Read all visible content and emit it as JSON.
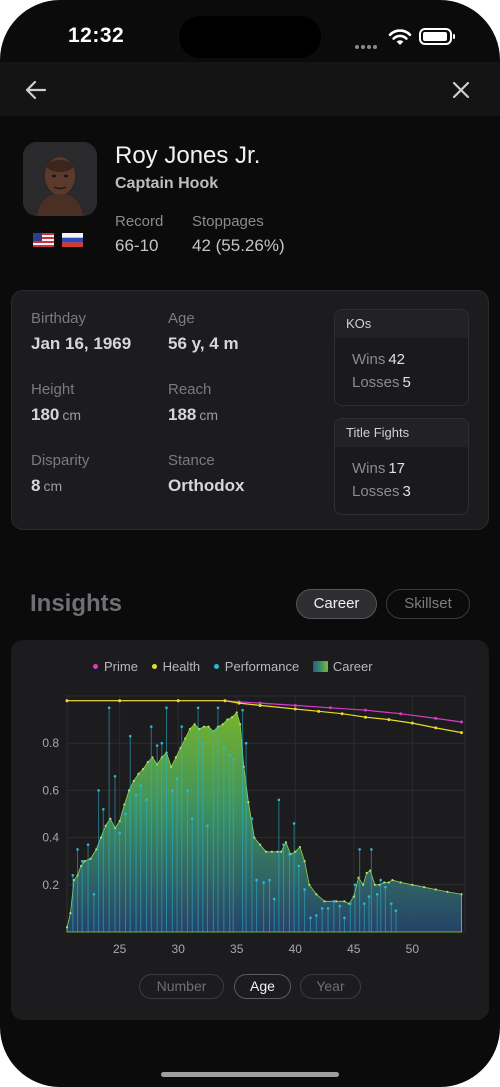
{
  "status_bar": {
    "time": "12:32"
  },
  "navbar": {
    "back_icon": "arrow-left-icon",
    "close_icon": "close-icon"
  },
  "fighter": {
    "name": "Roy Jones Jr.",
    "nickname": "Captain Hook",
    "flags": [
      "us-flag-icon",
      "ru-flag-icon"
    ],
    "record_label": "Record",
    "record_value": "66-10",
    "stoppages_label": "Stoppages",
    "stoppages_value": "42 (55.26%)"
  },
  "details": {
    "birthday_label": "Birthday",
    "birthday_value": "Jan 16, 1969",
    "age_label": "Age",
    "age_value": "56 y, 4 m",
    "height_label": "Height",
    "height_value": "180",
    "height_unit": "cm",
    "reach_label": "Reach",
    "reach_value": "188",
    "reach_unit": "cm",
    "disparity_label": "Disparity",
    "disparity_value": "8",
    "disparity_unit": "cm",
    "stance_label": "Stance",
    "stance_value": "Orthodox"
  },
  "kos": {
    "title": "KOs",
    "wins_label": "Wins",
    "wins_value": "42",
    "losses_label": "Losses",
    "losses_value": "5"
  },
  "title_fights": {
    "title": "Title Fights",
    "wins_label": "Wins",
    "wins_value": "17",
    "losses_label": "Losses",
    "losses_value": "3"
  },
  "insights": {
    "title": "Insights",
    "tabs": [
      {
        "label": "Career",
        "active": true
      },
      {
        "label": "Skillset",
        "active": false
      }
    ],
    "x_modes": [
      {
        "label": "Number",
        "active": false
      },
      {
        "label": "Age",
        "active": true
      },
      {
        "label": "Year",
        "active": false
      }
    ]
  },
  "chart_data": {
    "type": "area",
    "legend": [
      "Prime",
      "Health",
      "Performance",
      "Career"
    ],
    "colors": {
      "Prime": "#d63bc8",
      "Health": "#e8dc2a",
      "Performance": "#2ab8d8",
      "Career": "#7db836"
    },
    "xlim": [
      20.5,
      54.5
    ],
    "ylim": [
      0,
      1
    ],
    "x_ticks": [
      "25",
      "30",
      "35",
      "40",
      "45",
      "50"
    ],
    "y_ticks": [
      "0.2",
      "0.4",
      "0.6",
      "0.8"
    ],
    "grid": true,
    "series": [
      {
        "name": "Career",
        "points": [
          [
            20.5,
            0.02
          ],
          [
            20.8,
            0.08
          ],
          [
            21.1,
            0.22
          ],
          [
            21.4,
            0.24
          ],
          [
            21.7,
            0.28
          ],
          [
            22.0,
            0.3
          ],
          [
            22.5,
            0.31
          ],
          [
            23.0,
            0.35
          ],
          [
            23.4,
            0.4
          ],
          [
            23.8,
            0.45
          ],
          [
            24.2,
            0.48
          ],
          [
            24.6,
            0.44
          ],
          [
            25.0,
            0.47
          ],
          [
            25.4,
            0.54
          ],
          [
            25.8,
            0.6
          ],
          [
            26.2,
            0.64
          ],
          [
            26.6,
            0.67
          ],
          [
            27.0,
            0.69
          ],
          [
            27.4,
            0.72
          ],
          [
            27.8,
            0.74
          ],
          [
            28.2,
            0.71
          ],
          [
            28.6,
            0.74
          ],
          [
            29.0,
            0.76
          ],
          [
            29.4,
            0.7
          ],
          [
            29.8,
            0.74
          ],
          [
            30.2,
            0.78
          ],
          [
            30.6,
            0.82
          ],
          [
            31.0,
            0.86
          ],
          [
            31.4,
            0.88
          ],
          [
            31.8,
            0.86
          ],
          [
            32.2,
            0.87
          ],
          [
            32.6,
            0.87
          ],
          [
            33.0,
            0.85
          ],
          [
            33.4,
            0.87
          ],
          [
            33.8,
            0.88
          ],
          [
            34.2,
            0.9
          ],
          [
            34.6,
            0.91
          ],
          [
            35.0,
            0.93
          ],
          [
            35.3,
            0.88
          ],
          [
            35.6,
            0.7
          ],
          [
            36.0,
            0.55
          ],
          [
            36.5,
            0.4
          ],
          [
            37.0,
            0.37
          ],
          [
            37.5,
            0.34
          ],
          [
            38.0,
            0.34
          ],
          [
            38.5,
            0.34
          ],
          [
            38.8,
            0.34
          ],
          [
            39.2,
            0.38
          ],
          [
            39.6,
            0.33
          ],
          [
            40.0,
            0.34
          ],
          [
            40.4,
            0.36
          ],
          [
            40.8,
            0.3
          ],
          [
            41.2,
            0.2
          ],
          [
            41.8,
            0.16
          ],
          [
            42.5,
            0.13
          ],
          [
            43.5,
            0.13
          ],
          [
            44.2,
            0.13
          ],
          [
            44.6,
            0.12
          ],
          [
            45.0,
            0.15
          ],
          [
            45.4,
            0.23
          ],
          [
            45.8,
            0.2
          ],
          [
            46.1,
            0.25
          ],
          [
            46.4,
            0.26
          ],
          [
            46.8,
            0.2
          ],
          [
            47.2,
            0.2
          ],
          [
            47.6,
            0.21
          ],
          [
            48.0,
            0.21
          ],
          [
            48.3,
            0.22
          ],
          [
            49.0,
            0.21
          ],
          [
            50.0,
            0.2
          ],
          [
            51.0,
            0.19
          ],
          [
            52.0,
            0.18
          ],
          [
            53.0,
            0.17
          ],
          [
            54.2,
            0.16
          ]
        ]
      },
      {
        "name": "Prime",
        "points": [
          [
            20.5,
            0.98
          ],
          [
            25,
            0.98
          ],
          [
            30,
            0.98
          ],
          [
            34,
            0.98
          ],
          [
            35.2,
            0.975
          ],
          [
            37,
            0.97
          ],
          [
            40,
            0.96
          ],
          [
            43,
            0.95
          ],
          [
            46,
            0.94
          ],
          [
            49,
            0.925
          ],
          [
            52,
            0.905
          ],
          [
            54.2,
            0.89
          ]
        ]
      },
      {
        "name": "Health",
        "points": [
          [
            20.5,
            0.98
          ],
          [
            25,
            0.98
          ],
          [
            30,
            0.98
          ],
          [
            34,
            0.98
          ],
          [
            35.2,
            0.97
          ],
          [
            37,
            0.96
          ],
          [
            40,
            0.945
          ],
          [
            42,
            0.935
          ],
          [
            44,
            0.925
          ],
          [
            46,
            0.91
          ],
          [
            48,
            0.9
          ],
          [
            50,
            0.885
          ],
          [
            52,
            0.865
          ],
          [
            54.2,
            0.845
          ]
        ]
      },
      {
        "name": "Performance",
        "points": [
          [
            21.0,
            0.24
          ],
          [
            21.4,
            0.35
          ],
          [
            21.8,
            0.3
          ],
          [
            22.3,
            0.37
          ],
          [
            22.8,
            0.16
          ],
          [
            23.2,
            0.6
          ],
          [
            23.6,
            0.52
          ],
          [
            24.1,
            0.95
          ],
          [
            24.6,
            0.66
          ],
          [
            25.0,
            0.42
          ],
          [
            25.5,
            0.5
          ],
          [
            25.9,
            0.83
          ],
          [
            26.4,
            0.58
          ],
          [
            26.8,
            0.62
          ],
          [
            27.3,
            0.56
          ],
          [
            27.7,
            0.87
          ],
          [
            28.2,
            0.79
          ],
          [
            28.6,
            0.8
          ],
          [
            29.0,
            0.95
          ],
          [
            29.5,
            0.6
          ],
          [
            29.9,
            0.65
          ],
          [
            30.3,
            0.87
          ],
          [
            30.8,
            0.6
          ],
          [
            31.2,
            0.48
          ],
          [
            31.7,
            0.95
          ],
          [
            32.1,
            0.8
          ],
          [
            32.5,
            0.45
          ],
          [
            33.0,
            0.85
          ],
          [
            33.4,
            0.95
          ],
          [
            33.9,
            0.78
          ],
          [
            34.4,
            0.75
          ],
          [
            34.7,
            0.73
          ],
          [
            35.5,
            0.94
          ],
          [
            35.8,
            0.8
          ],
          [
            36.3,
            0.48
          ],
          [
            36.7,
            0.22
          ],
          [
            37.3,
            0.21
          ],
          [
            37.8,
            0.22
          ],
          [
            38.2,
            0.14
          ],
          [
            38.6,
            0.56
          ],
          [
            39.0,
            0.37
          ],
          [
            39.5,
            0.33
          ],
          [
            39.9,
            0.46
          ],
          [
            40.3,
            0.28
          ],
          [
            40.8,
            0.18
          ],
          [
            41.3,
            0.06
          ],
          [
            41.8,
            0.07
          ],
          [
            42.3,
            0.1
          ],
          [
            42.8,
            0.1
          ],
          [
            43.3,
            0.13
          ],
          [
            43.8,
            0.11
          ],
          [
            44.2,
            0.06
          ],
          [
            44.7,
            0.12
          ],
          [
            45.1,
            0.2
          ],
          [
            45.5,
            0.35
          ],
          [
            45.9,
            0.12
          ],
          [
            46.3,
            0.15
          ],
          [
            46.5,
            0.35
          ],
          [
            47.0,
            0.16
          ],
          [
            47.3,
            0.22
          ],
          [
            47.7,
            0.19
          ],
          [
            48.2,
            0.12
          ],
          [
            48.6,
            0.09
          ]
        ]
      }
    ]
  }
}
